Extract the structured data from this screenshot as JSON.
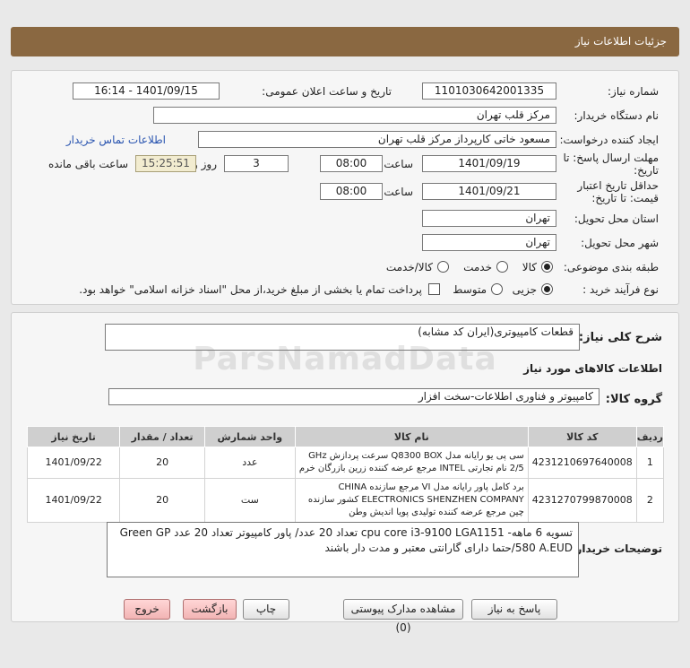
{
  "header": {
    "title": "جزئیات اطلاعات نیاز"
  },
  "form": {
    "need_number_label": "شماره نیاز:",
    "need_number": "1101030642001335",
    "announce_label": "تاریخ و ساعت اعلان عمومی:",
    "announce_value": "1401/09/15 - 16:14",
    "buyer_org_label": "نام دستگاه خریدار:",
    "buyer_org": "مرکز قلب تهران",
    "requester_label": "ایجاد کننده درخواست:",
    "requester": "مسعود خاتی کارپرداز مرکز قلب تهران",
    "contact_link": "اطلاعات تماس خریدار",
    "deadline_label": "مهلت ارسال پاسخ: تا تاریخ:",
    "deadline_date": "1401/09/19",
    "time_label": "ساعت",
    "deadline_time": "08:00",
    "days_value": "3",
    "days_label": "روز و",
    "remaining_time": "15:25:51",
    "remaining_label": "ساعت باقی مانده",
    "validity_label": "حداقل تاریخ اعتبار قیمت: تا تاریخ:",
    "validity_date": "1401/09/21",
    "validity_time": "08:00",
    "province_label": "استان محل تحویل:",
    "province": "تهران",
    "city_label": "شهر محل تحویل:",
    "city": "تهران",
    "category_label": "طبقه بندی موضوعی:",
    "category_options": [
      "کالا",
      "خدمت",
      "کالا/خدمت"
    ],
    "process_label": "نوع فرآیند خرید :",
    "process_options": [
      "جزیی",
      "متوسط"
    ],
    "payment_note": "پرداخت تمام یا بخشی از مبلغ خرید،از محل \"اسناد خزانه اسلامی\" خواهد بود."
  },
  "details": {
    "summary_label": "شرح کلی نیاز:",
    "summary": "قطعات کامپیوتری(ایران کد مشابه)",
    "goods_info_title": "اطلاعات کالاهای مورد نیاز",
    "goods_group_label": "گروه کالا:",
    "goods_group": "کامپیوتر و فناوری اطلاعات-سخت افزار",
    "table": {
      "headers": [
        "ردیف",
        "کد کالا",
        "نام کالا",
        "واحد شمارش",
        "تعداد / مقدار",
        "تاریخ نیاز"
      ],
      "rows": [
        {
          "row": "1",
          "code": "4231210697640008",
          "name": "سی پی یو رایانه مدل Q8300 BOX سرعت پردازش GHz 2/5 نام تجارتی INTEL مرجع عرضه کننده زرین بازرگان خرم",
          "unit": "عدد",
          "qty": "20",
          "date": "1401/09/22"
        },
        {
          "row": "2",
          "code": "4231270799870008",
          "name": "برد کامل پاور رایانه مدل VI مرجع سازنده CHINA ELECTRONICS SHENZHEN COMPANY کشور سازنده چین مرجع عرضه کننده تولیدی پویا اندیش وطن",
          "unit": "ست",
          "qty": "20",
          "date": "1401/09/22"
        }
      ]
    },
    "notes_label": "توضیحات خریدار:",
    "notes": "تسویه 6 ماهه- cpu core i3-9100 LGA1151 تعداد 20 عدد/ پاور کامپیوتر تعداد 20 عدد Green GP 580 A.EUD/حتما دارای گارانتی معتبر و مدت دار باشند"
  },
  "buttons": {
    "reply": "پاسخ به نیاز",
    "attachments": "مشاهده مدارک پیوستی (0)",
    "print": "چاپ",
    "back": "بازگشت",
    "exit": "خروج"
  },
  "watermark": "ParsNamadData"
}
